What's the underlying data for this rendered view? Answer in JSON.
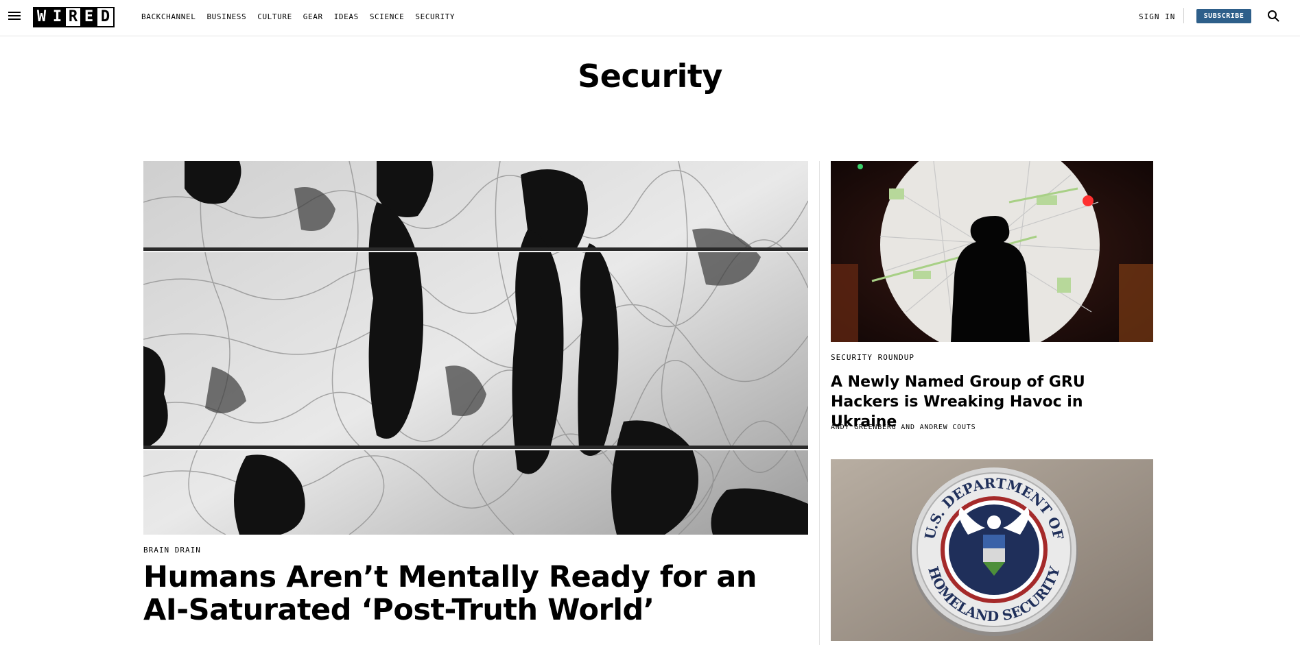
{
  "header": {
    "logo_letters": [
      "W",
      "I",
      "R",
      "E",
      "D"
    ],
    "nav": [
      "BACKCHANNEL",
      "BUSINESS",
      "CULTURE",
      "GEAR",
      "IDEAS",
      "SCIENCE",
      "SECURITY"
    ],
    "sign_in": "SIGN IN",
    "subscribe": "SUBSCRIBE",
    "accent_color": "#2e5f8a"
  },
  "page": {
    "title": "Security"
  },
  "main_story": {
    "kicker": "BRAIN DRAIN",
    "headline": "Humans Aren’t Mentally Ready for an AI-Saturated ‘Post-Truth World’",
    "image": "black-and-white reflection of pedestrians in rippled water"
  },
  "side_stories": [
    {
      "kicker": "SECURITY ROUNDUP",
      "headline": "A Newly Named Group of GRU Hackers is Wreaking Havoc in Ukraine",
      "byline": "ANDY GREENBERG AND ANDREW COUTS",
      "image": "silhouette of person in front of illuminated city map"
    },
    {
      "image": "U.S. Department of Homeland Security seal",
      "seal_text_top": "U.S. DEPARTMENT OF",
      "seal_text_bottom": "HOMELAND SECURITY"
    }
  ]
}
